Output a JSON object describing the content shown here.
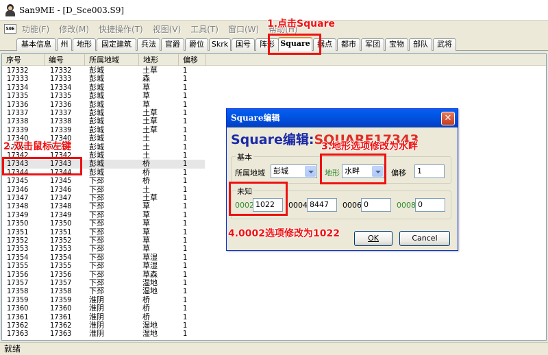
{
  "window": {
    "title": "San9ME - [D_Sce003.S9]"
  },
  "menu": {
    "items": [
      "功能(F)",
      "修改(M)",
      "快捷操作(T)",
      "视图(V)",
      "工具(T)",
      "窗口(W)",
      "帮助(H)"
    ]
  },
  "tabs": [
    "基本信息",
    "州",
    "地形",
    "固定建筑",
    "兵法",
    "官爵",
    "爵位",
    "Skrk",
    "国号",
    "阵形",
    "Square",
    "据点",
    "都市",
    "军团",
    "宝物",
    "部队",
    "武将"
  ],
  "active_tab": "Square",
  "list": {
    "columns": [
      "序号",
      "编号",
      "所属地域",
      "地形",
      "偏移"
    ],
    "rows": [
      [
        "17332",
        "17332",
        "彭城",
        "土草",
        "1"
      ],
      [
        "17333",
        "17333",
        "彭城",
        "森",
        "1"
      ],
      [
        "17334",
        "17334",
        "彭城",
        "草",
        "1"
      ],
      [
        "17335",
        "17335",
        "彭城",
        "草",
        "1"
      ],
      [
        "17336",
        "17336",
        "彭城",
        "草",
        "1"
      ],
      [
        "17337",
        "17337",
        "彭城",
        "土草",
        "1"
      ],
      [
        "17338",
        "17338",
        "彭城",
        "土草",
        "1"
      ],
      [
        "17339",
        "17339",
        "彭城",
        "土草",
        "1"
      ],
      [
        "17340",
        "17340",
        "彭城",
        "土",
        "1"
      ],
      [
        "17341",
        "17341",
        "彭城",
        "土",
        "1"
      ],
      [
        "17342",
        "17342",
        "彭城",
        "土",
        "1"
      ],
      [
        "17343",
        "17343",
        "彭城",
        "桥",
        "1"
      ],
      [
        "17344",
        "17344",
        "彭城",
        "桥",
        "1"
      ],
      [
        "17345",
        "17345",
        "下邳",
        "桥",
        "1"
      ],
      [
        "17346",
        "17346",
        "下邳",
        "土",
        "1"
      ],
      [
        "17347",
        "17347",
        "下邳",
        "土草",
        "1"
      ],
      [
        "17348",
        "17348",
        "下邳",
        "草",
        "1"
      ],
      [
        "17349",
        "17349",
        "下邳",
        "草",
        "1"
      ],
      [
        "17350",
        "17350",
        "下邳",
        "草",
        "1"
      ],
      [
        "17351",
        "17351",
        "下邳",
        "草",
        "1"
      ],
      [
        "17352",
        "17352",
        "下邳",
        "草",
        "1"
      ],
      [
        "17353",
        "17353",
        "下邳",
        "草",
        "1"
      ],
      [
        "17354",
        "17354",
        "下邳",
        "草湿",
        "1"
      ],
      [
        "17355",
        "17355",
        "下邳",
        "草湿",
        "1"
      ],
      [
        "17356",
        "17356",
        "下邳",
        "草森",
        "1"
      ],
      [
        "17357",
        "17357",
        "下邳",
        "湿地",
        "1"
      ],
      [
        "17358",
        "17358",
        "下邳",
        "湿地",
        "1"
      ],
      [
        "17359",
        "17359",
        "淮阴",
        "桥",
        "1"
      ],
      [
        "17360",
        "17360",
        "淮阴",
        "桥",
        "1"
      ],
      [
        "17361",
        "17361",
        "淮阴",
        "桥",
        "1"
      ],
      [
        "17362",
        "17362",
        "淮阴",
        "湿地",
        "1"
      ],
      [
        "17363",
        "17363",
        "淮阴",
        "湿地",
        "1"
      ]
    ],
    "selected_row": "17343"
  },
  "status": {
    "text": "就绪"
  },
  "dialog": {
    "title": "Square编辑",
    "heading_prefix": "Square编辑:",
    "heading_name": "SQUARE17343",
    "group_basic": "基本",
    "region_label": "所属地域",
    "region_value": "彭城",
    "terrain_label": "地形",
    "terrain_value": "水畔",
    "offset_label": "偏移",
    "offset_value": "1",
    "group_unknown": "未知",
    "f0002_label": "0002",
    "f0002_value": "1022",
    "f0004_label": "0004",
    "f0004_value": "8447",
    "f0006_label": "0006",
    "f0006_value": "0",
    "f0008_label": "0008",
    "f0008_value": "0",
    "ok_label": "OK",
    "cancel_label": "Cancel"
  },
  "annotations": {
    "step1": "1.点击Square",
    "step2": "2.双击鼠标左键",
    "step3": "3.地形选项修改为水畔",
    "step4": "4.0002选项修改为1022"
  },
  "colors": {
    "annotation_red": "#ee1111",
    "dialog_title_blue": "#0245d1",
    "heading_blue": "#1b2aa8",
    "heading_red": "#e02d28",
    "label_green": "#2e8b2e"
  }
}
